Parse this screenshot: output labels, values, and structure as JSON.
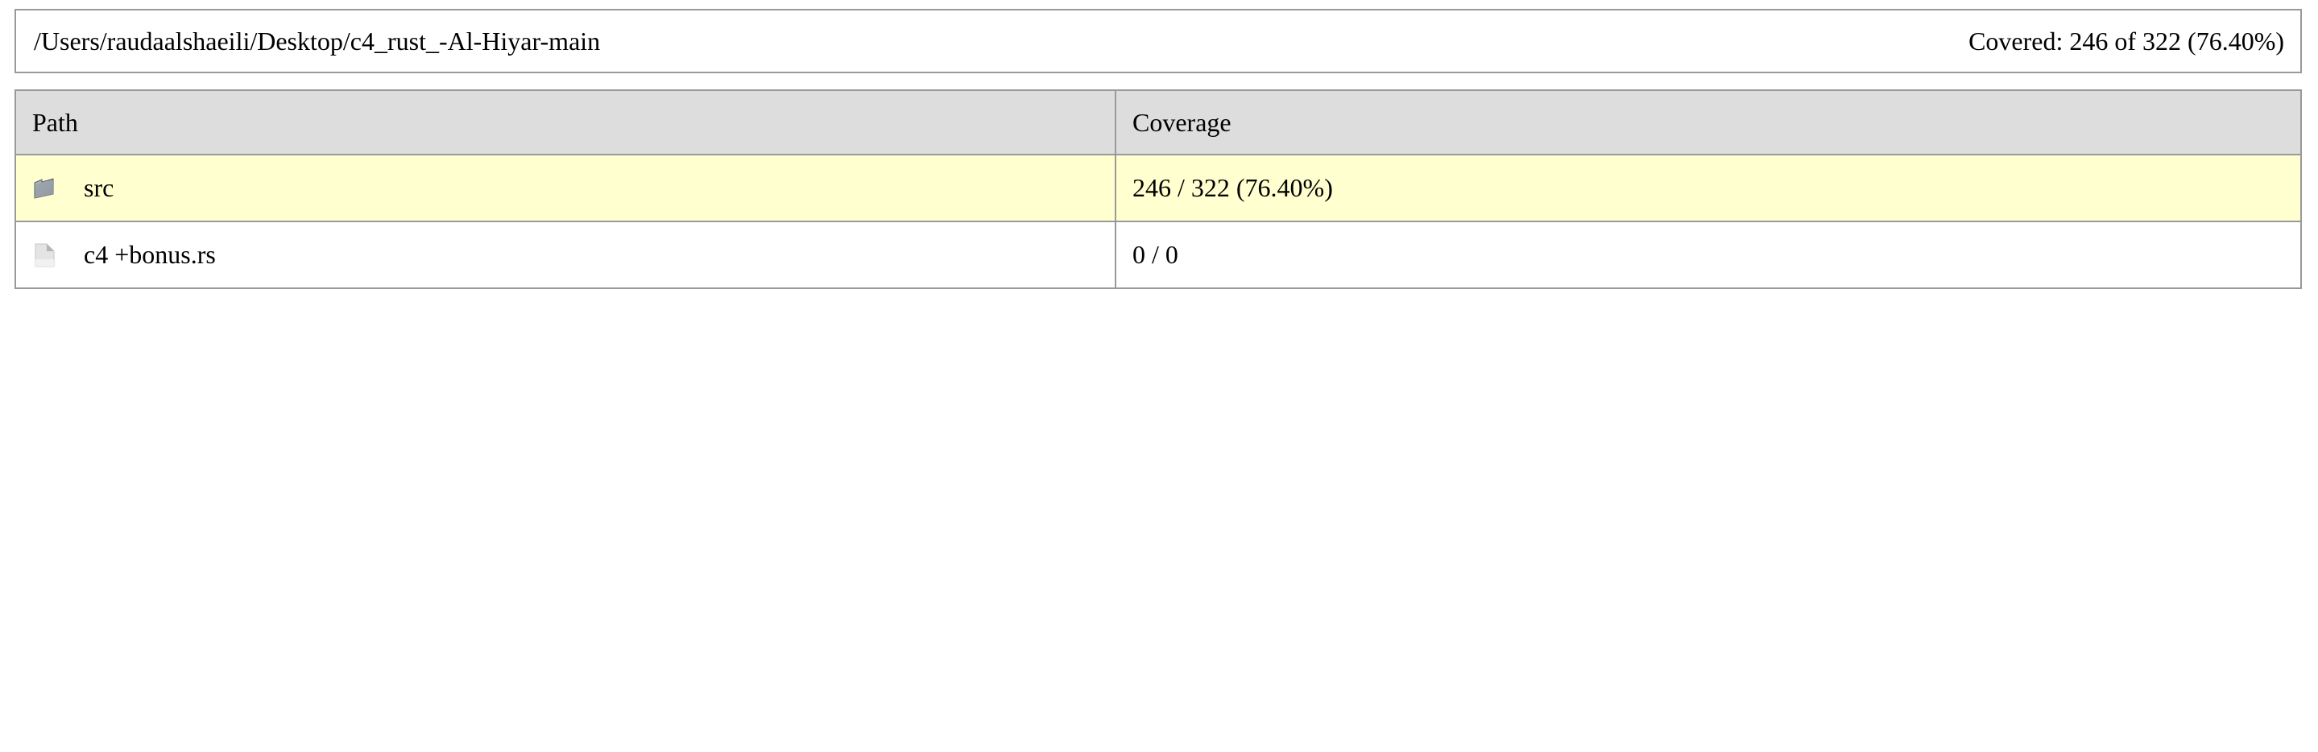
{
  "summary": {
    "path": "/Users/raudaalshaeili/Desktop/c4_rust_-Al-Hiyar-main",
    "covered": "Covered: 246 of 322 (76.40%)"
  },
  "table": {
    "headers": {
      "path": "Path",
      "coverage": "Coverage"
    },
    "rows": [
      {
        "icon": "folder-icon",
        "name": "src",
        "coverage": "246 / 322 (76.40%)",
        "highlight": "#ffffd0"
      },
      {
        "icon": "file-icon",
        "name": "c4 +bonus.rs",
        "coverage": "0 / 0",
        "highlight": "#ffffff"
      }
    ]
  },
  "colors": {
    "border": "#999999",
    "header_background": "#dddddd",
    "partial_coverage_background": "#ffffd0"
  }
}
